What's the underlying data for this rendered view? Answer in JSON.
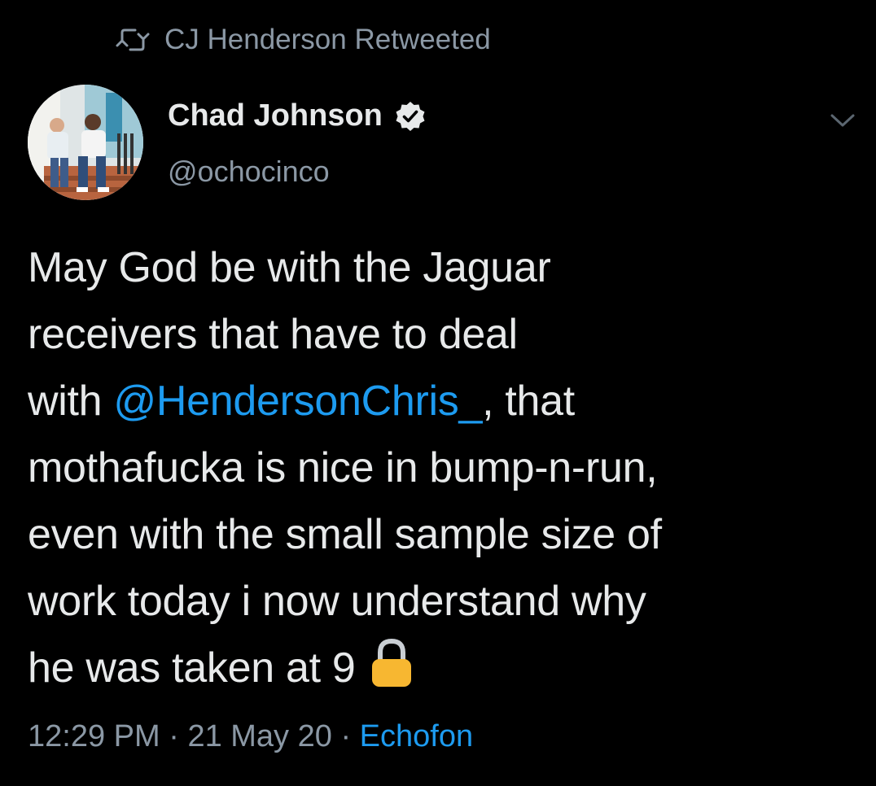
{
  "retweet": {
    "text": "CJ Henderson Retweeted",
    "icon": "retweet-icon"
  },
  "author": {
    "name": "Chad Johnson",
    "handle": "@ochocinco",
    "verified": true,
    "avatar_icon": "avatar-photo"
  },
  "tweet": {
    "lines": [
      {
        "text": "May God be with the Jaguar"
      },
      {
        "text": "receivers that have to deal"
      },
      {
        "prefix": "with ",
        "mention": "@HendersonChris_",
        "suffix": ", that"
      },
      {
        "text": "mothafucka is nice in bump-n-run,"
      },
      {
        "text": "even with the small sample size of"
      },
      {
        "text": "work today i now understand why"
      },
      {
        "text": "he was taken at 9",
        "emoji": "lock-icon"
      }
    ]
  },
  "meta": {
    "time": "12:29 PM",
    "separator1": " · ",
    "date": "21 May 20",
    "separator2": " · ",
    "source": "Echofon"
  },
  "colors": {
    "background": "#000000",
    "text": "#e7e9ea",
    "muted": "#8b98a5",
    "link": "#1d9bf0",
    "lock": "#f7b731"
  }
}
